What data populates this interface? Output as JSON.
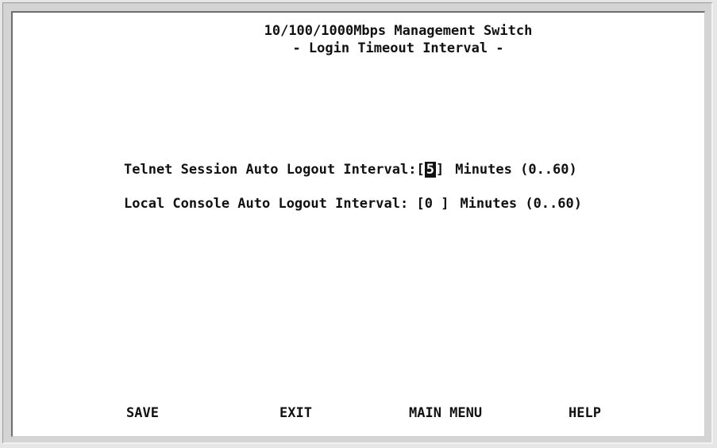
{
  "header": {
    "title": "10/100/1000Mbps Management Switch",
    "subtitle": "- Login Timeout Interval -"
  },
  "settings": [
    {
      "label": "Telnet Session Auto Logout Interval:",
      "open": "[",
      "value": "5",
      "close": "]",
      "units": "Minutes (0..60)",
      "active": true
    },
    {
      "label": "Local Console Auto Logout Interval:",
      "open": " [",
      "value": "0",
      "close": " ]",
      "units": "Minutes (0..60)",
      "active": false
    }
  ],
  "menu": {
    "save": "SAVE",
    "exit": "EXIT",
    "main_menu": "MAIN MENU",
    "help": "HELP"
  },
  "colors": {
    "background": "#ffffff",
    "text": "#111111",
    "highlight": "#111111"
  }
}
